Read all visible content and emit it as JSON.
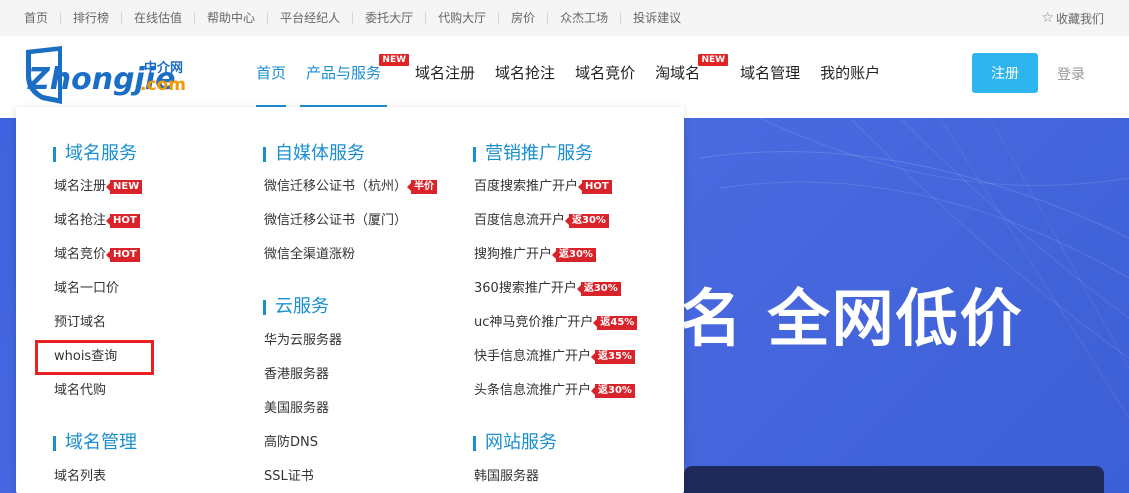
{
  "topbar": {
    "links": [
      "首页",
      "排行榜",
      "在线估值",
      "帮助中心",
      "平台经纪人",
      "委托大厅",
      "代购大厅",
      "房价",
      "众杰工场",
      "投诉建议"
    ],
    "favorite": "收藏我们"
  },
  "header": {
    "logo_text": "Zhongjie",
    "logo_cn": "中介网",
    "logo_com": ".com",
    "nav": [
      {
        "label": "首页",
        "active": true
      },
      {
        "label": "产品与服务",
        "badge": "NEW",
        "active": true
      },
      {
        "label": "域名注册"
      },
      {
        "label": "域名抢注"
      },
      {
        "label": "域名竞价"
      },
      {
        "label": "淘域名",
        "badge": "NEW"
      },
      {
        "label": "域名管理"
      },
      {
        "label": "我的账户"
      }
    ],
    "register": "注册",
    "login": "登录"
  },
  "banner": {
    "text": "名 全网低价"
  },
  "menu": {
    "col1": {
      "title": "域名服务",
      "items": [
        {
          "label": "域名注册",
          "tag": "NEW"
        },
        {
          "label": "域名抢注",
          "tag": "HOT"
        },
        {
          "label": "域名竞价",
          "tag": "HOT"
        },
        {
          "label": "域名一口价"
        },
        {
          "label": "预订域名"
        },
        {
          "label": "whois查询"
        },
        {
          "label": "域名代购"
        }
      ],
      "title2": "域名管理",
      "items2": [
        {
          "label": "域名列表"
        }
      ]
    },
    "col2": {
      "title": "自媒体服务",
      "items": [
        {
          "label": "微信迁移公证书（杭州）",
          "tag": "半价"
        },
        {
          "label": "微信迁移公证书（厦门）"
        },
        {
          "label": "微信全渠道涨粉"
        }
      ],
      "title2": "云服务",
      "items2": [
        {
          "label": "华为云服务器"
        },
        {
          "label": "香港服务器"
        },
        {
          "label": "美国服务器"
        },
        {
          "label": "高防DNS"
        },
        {
          "label": "SSL证书"
        }
      ]
    },
    "col3": {
      "title": "营销推广服务",
      "items": [
        {
          "label": "百度搜索推广开户",
          "tag": "HOT"
        },
        {
          "label": "百度信息流开户",
          "tag": "返30%"
        },
        {
          "label": "搜狗推广开户",
          "tag": "返30%"
        },
        {
          "label": "360搜索推广开户",
          "tag": "返30%"
        },
        {
          "label": "uc神马竞价推广开户",
          "tag": "返45%"
        },
        {
          "label": "快手信息流推广开户",
          "tag": "返35%"
        },
        {
          "label": "头条信息流推广开户",
          "tag": "返30%"
        }
      ],
      "title2": "网站服务",
      "items2": [
        {
          "label": "韩国服务器"
        }
      ]
    }
  },
  "colors": {
    "accent": "#1a8fd0",
    "tag": "#d9232b",
    "register_button": "#2eb5ef",
    "banner": "#3e63de",
    "highlight": "#e8201f"
  }
}
